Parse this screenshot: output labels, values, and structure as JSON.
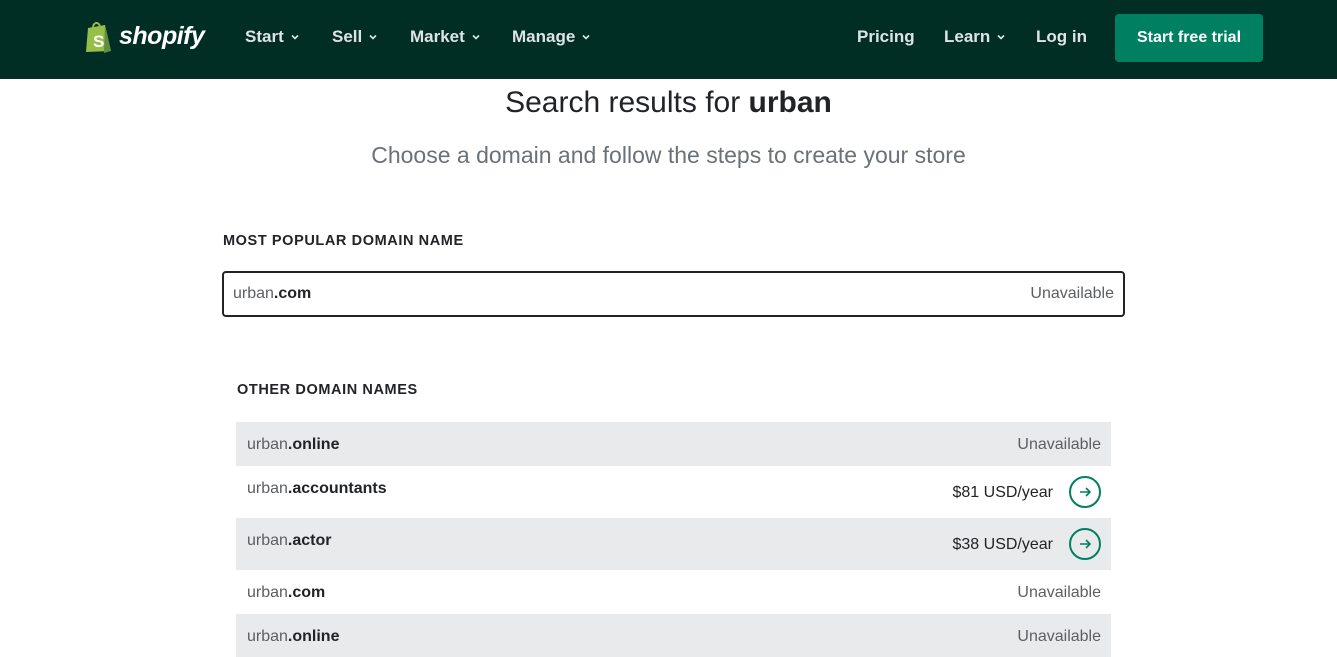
{
  "header": {
    "logo_text": "shopify",
    "nav": [
      {
        "label": "Start",
        "has_dropdown": true
      },
      {
        "label": "Sell",
        "has_dropdown": true
      },
      {
        "label": "Market",
        "has_dropdown": true
      },
      {
        "label": "Manage",
        "has_dropdown": true
      }
    ],
    "right_nav": {
      "pricing": "Pricing",
      "learn": "Learn",
      "login": "Log in"
    },
    "cta": "Start free trial"
  },
  "search": {
    "title_prefix": "Search results for",
    "query": "urban",
    "subtitle": "Choose a domain and follow the steps to create your store"
  },
  "popular": {
    "heading": "MOST POPULAR DOMAIN NAME",
    "domain": {
      "name": "urban",
      "tld": ".com",
      "status": "Unavailable"
    }
  },
  "other": {
    "heading": "OTHER DOMAIN NAMES",
    "rows": [
      {
        "name": "urban",
        "tld": ".online",
        "status": "Unavailable"
      },
      {
        "name": "urban",
        "tld": ".accountants",
        "price": "$81 USD/year"
      },
      {
        "name": "urban",
        "tld": ".actor",
        "price": "$38 USD/year"
      },
      {
        "name": "urban",
        "tld": ".com",
        "status": "Unavailable"
      },
      {
        "name": "urban",
        "tld": ".online",
        "status": "Unavailable"
      }
    ]
  },
  "colors": {
    "header_bg": "#002e25",
    "accent": "#008060",
    "row_shade": "#e9eaec"
  }
}
